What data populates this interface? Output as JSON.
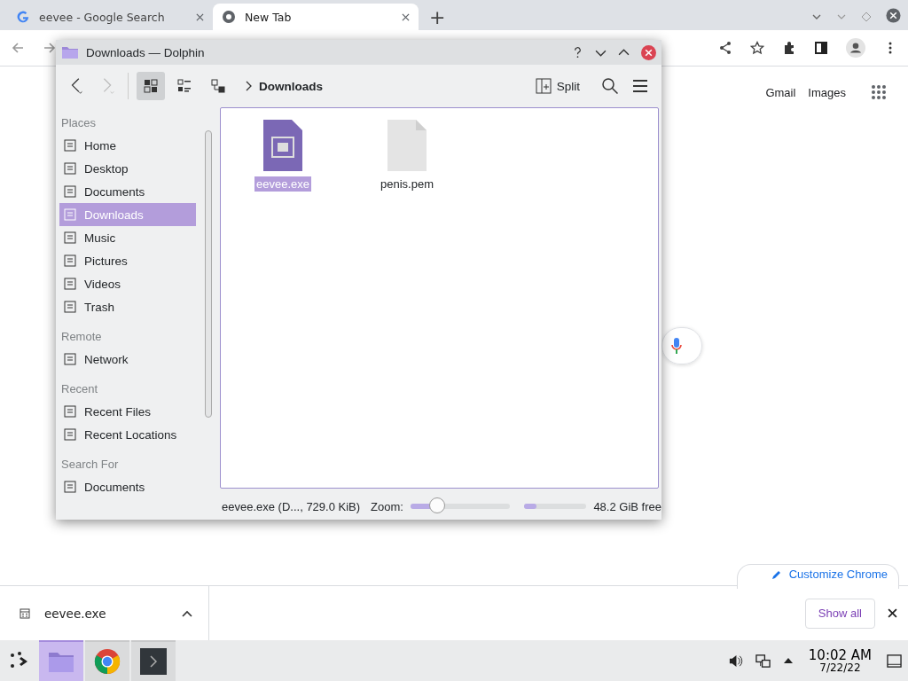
{
  "browser": {
    "tabs": [
      {
        "title": "eevee - Google Search",
        "selected": false
      },
      {
        "title": "New Tab",
        "selected": true
      }
    ],
    "new_tab_button": "+",
    "links": [
      "Gmail",
      "Images"
    ],
    "customize_button": "Customize Chrome"
  },
  "dolphin": {
    "title": "Downloads — Dolphin",
    "breadcrumb": "Downloads",
    "split_button": "Split",
    "view_modes": [
      {
        "selected": true
      },
      {
        "selected": false
      },
      {
        "selected": false
      }
    ],
    "places": [
      {
        "heading": "Places",
        "items": [
          {
            "label": "Home",
            "selected": false
          },
          {
            "label": "Desktop",
            "selected": false
          },
          {
            "label": "Documents",
            "selected": false
          },
          {
            "label": "Downloads",
            "selected": true
          },
          {
            "label": "Music",
            "selected": false
          },
          {
            "label": "Pictures",
            "selected": false
          },
          {
            "label": "Videos",
            "selected": false
          },
          {
            "label": "Trash",
            "selected": false
          }
        ]
      },
      {
        "heading": "Remote",
        "items": [
          {
            "label": "Network",
            "selected": false
          }
        ]
      },
      {
        "heading": "Recent",
        "items": [
          {
            "label": "Recent Files",
            "selected": false
          },
          {
            "label": "Recent Locations",
            "selected": false
          }
        ]
      },
      {
        "heading": "Search For",
        "items": [
          {
            "label": "Documents",
            "selected": false
          }
        ]
      }
    ],
    "files": [
      {
        "name": "eevee.exe",
        "kind": "executable",
        "selected": true
      },
      {
        "name": "penis.pem",
        "kind": "document",
        "selected": false
      }
    ],
    "status": {
      "info": "eevee.exe (D..., 729.0 KiB)",
      "zoom_label": "Zoom:",
      "zoom": {
        "level": 0.28
      },
      "space": {
        "level": 0.2
      },
      "free": "48.2 GiB free"
    }
  },
  "download_shelf": {
    "items": [
      {
        "name": "eevee.exe"
      }
    ],
    "show_all": "Show all"
  },
  "taskbar": {
    "tasks": [
      {
        "kind": "files",
        "selected": true
      },
      {
        "kind": "chrome",
        "selected": false
      },
      {
        "kind": "terminal",
        "selected": false
      }
    ],
    "time": "10:02 AM",
    "date": "7/22/22"
  }
}
